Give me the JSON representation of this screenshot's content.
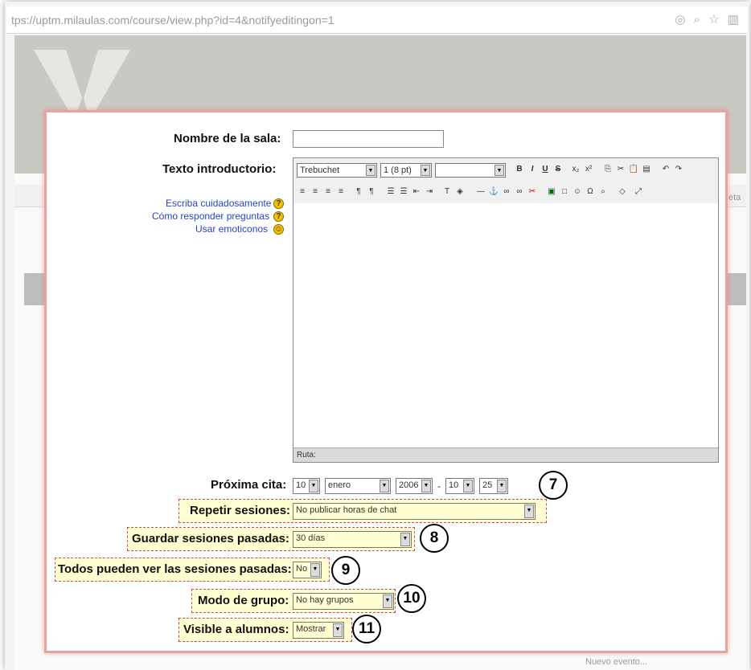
{
  "browser": {
    "url": "tps://uptm.milaulas.com/course/view.php?id=4&notifyeditingon=1",
    "icons": "◎ ⌕ ☆ ▥"
  },
  "background": {
    "side_text_1": "eta",
    "bottom_text": "Nuevo evento..."
  },
  "form": {
    "room_name": {
      "label": "Nombre de la sala:",
      "value": ""
    },
    "intro_text": {
      "label": "Texto introductorio:"
    },
    "help_links": [
      {
        "label": "Escriba cuidadosamente",
        "icon": "help-icon"
      },
      {
        "label": "Cómo responder preguntas",
        "icon": "help-icon"
      },
      {
        "label": "Usar emoticonos",
        "icon": "smiley-icon"
      }
    ],
    "editor": {
      "font": "Trebuchet",
      "size": "1 (8 pt)",
      "format": "",
      "path_label": "Ruta:"
    },
    "next_session": {
      "label": "Próxima cita:",
      "day": "10",
      "month": "enero",
      "year": "2006",
      "hour": "10",
      "minute": "25",
      "sep": "-"
    },
    "repeat": {
      "label": "Repetir sesiones:",
      "value": "No publicar horas de chat"
    },
    "keep": {
      "label": "Guardar sesiones pasadas:",
      "value": "30 días"
    },
    "everyone": {
      "label": "Todos pueden ver las sesiones pasadas:",
      "value": "No"
    },
    "group_mode": {
      "label": "Modo de grupo:",
      "value": "No hay grupos"
    },
    "visible": {
      "label": "Visible a alumnos:",
      "value": "Mostrar"
    }
  },
  "callouts": [
    "7",
    "8",
    "9",
    "10",
    "11"
  ]
}
